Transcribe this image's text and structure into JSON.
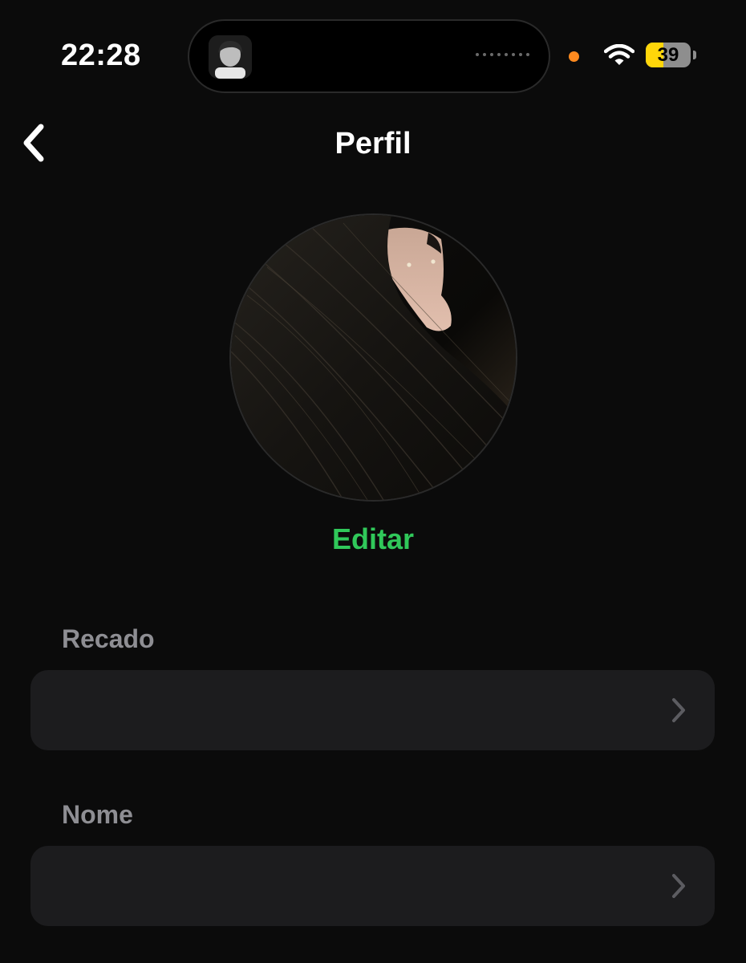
{
  "status_bar": {
    "time": "22:28",
    "battery_percent": 39,
    "battery_label": "39",
    "privacy_indicator_color": "#ff8a1f",
    "icons": [
      "wifi-icon",
      "battery-icon"
    ]
  },
  "nav": {
    "back_icon": "chevron-left-icon",
    "title": "Perfil"
  },
  "profile": {
    "edit_label": "Editar",
    "accent_color": "#30c85a"
  },
  "fields": [
    {
      "label": "Recado",
      "value": ""
    },
    {
      "label": "Nome",
      "value": ""
    }
  ]
}
